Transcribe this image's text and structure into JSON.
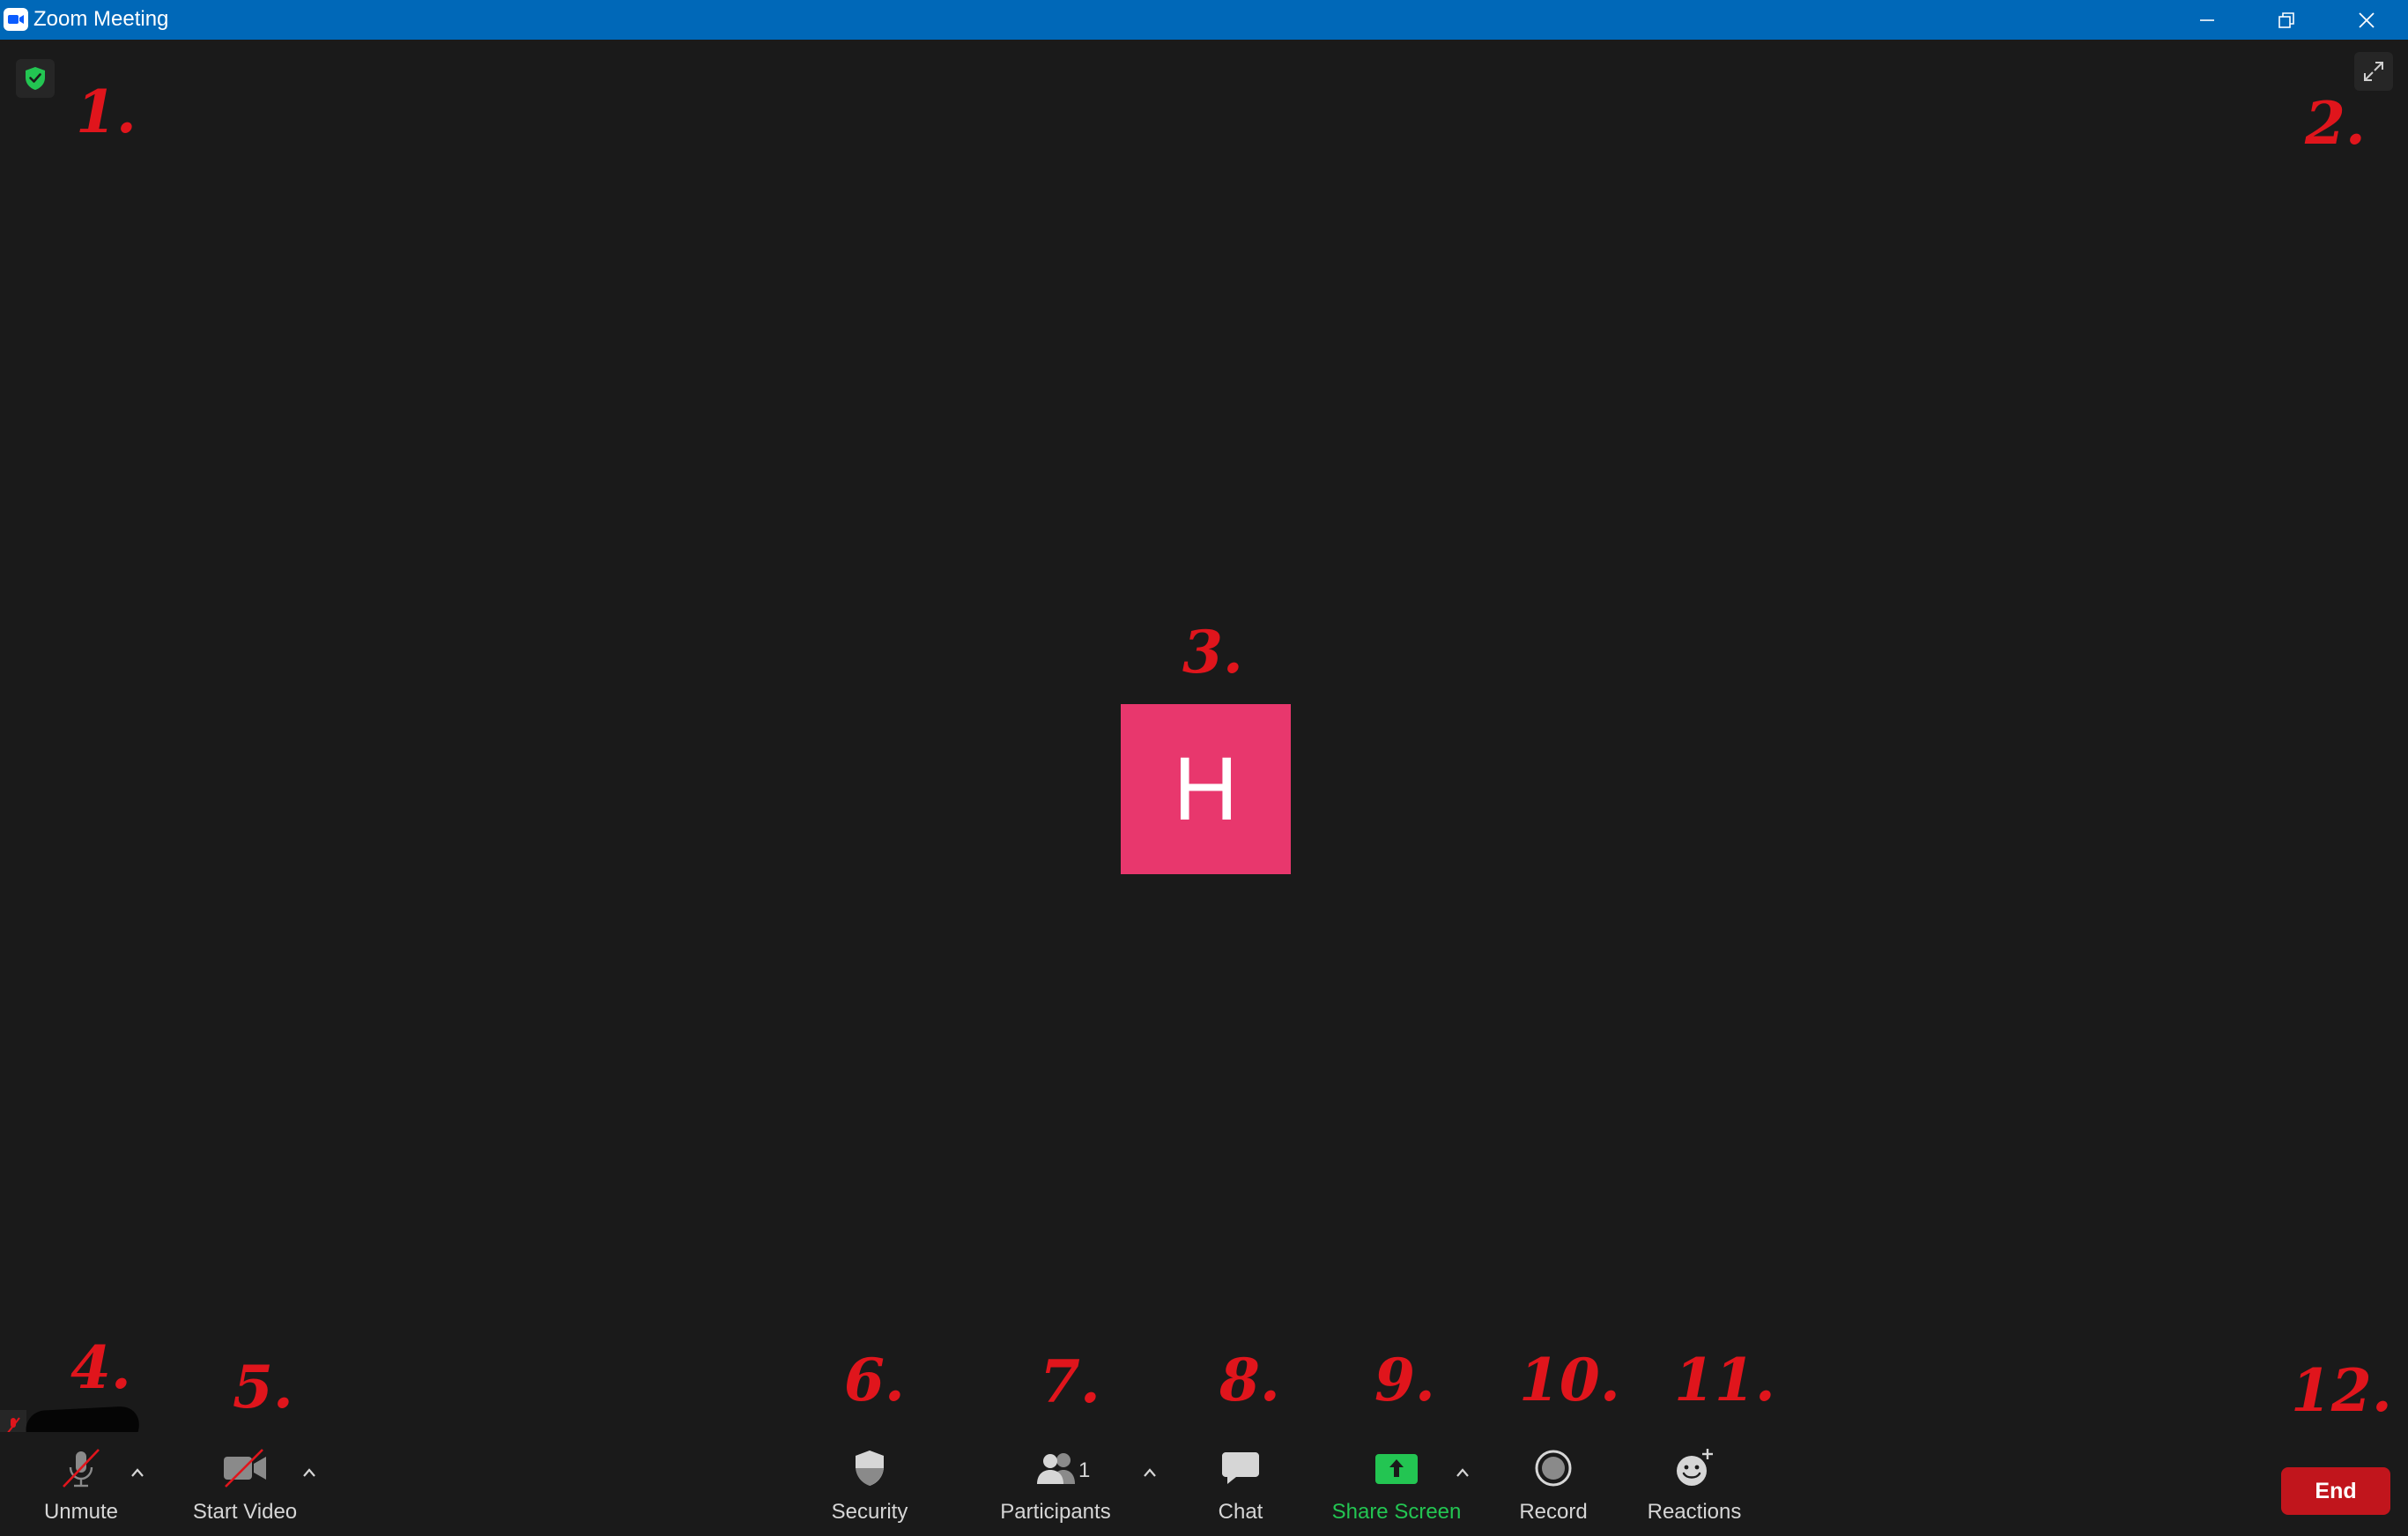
{
  "window": {
    "title": "Zoom Meeting"
  },
  "meeting": {
    "avatar_initial": "H",
    "avatar_color": "#e8376d",
    "security_badge_icon": "shield-check-icon",
    "fullscreen_icon": "expand-icon"
  },
  "annotations": [
    "1.",
    "2.",
    "3.",
    "4.",
    "5.",
    "6.",
    "7.",
    "8.",
    "9.",
    "10.",
    "11.",
    "12."
  ],
  "toolbar": {
    "unmute_label": "Unmute",
    "start_video_label": "Start Video",
    "security_label": "Security",
    "participants_label": "Participants",
    "participants_count": "1",
    "chat_label": "Chat",
    "share_screen_label": "Share Screen",
    "record_label": "Record",
    "reactions_label": "Reactions",
    "end_label": "End"
  },
  "colors": {
    "titlebar": "#0068b8",
    "background": "#1a1a1a",
    "share_green": "#23c552",
    "end_red": "#c1151c",
    "annotation_red": "#e0151c"
  }
}
